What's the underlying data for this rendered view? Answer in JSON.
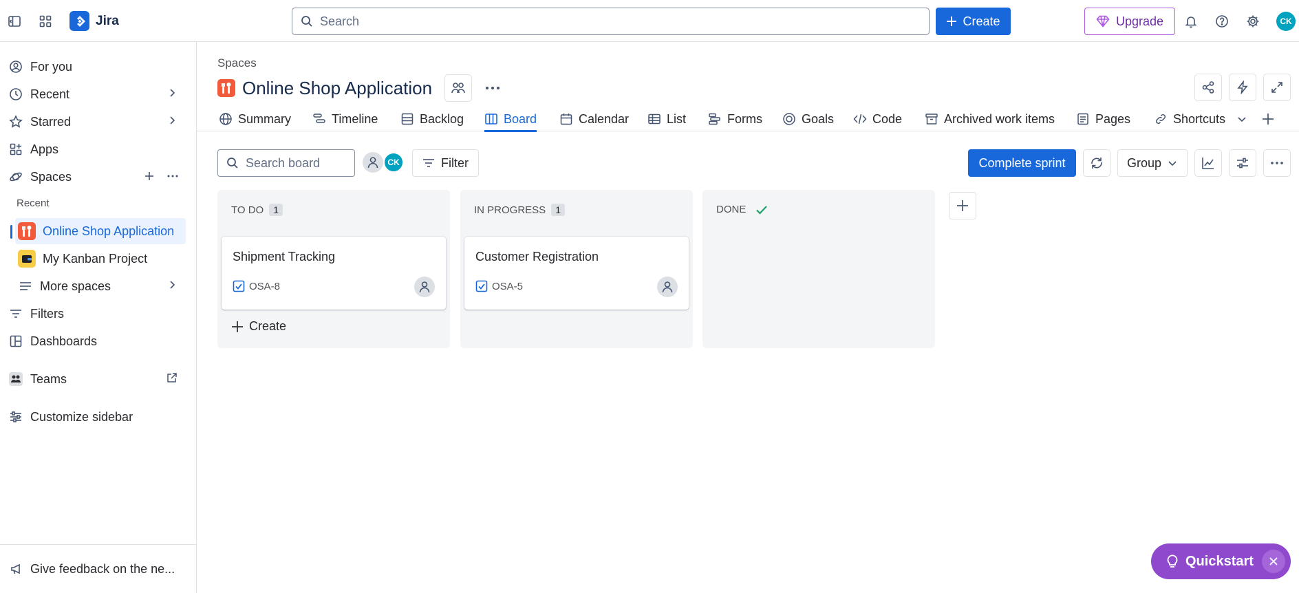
{
  "topbar": {
    "app_name": "Jira",
    "search_placeholder": "Search",
    "create_label": "Create",
    "upgrade_label": "Upgrade",
    "user_initials": "CK"
  },
  "sidebar": {
    "for_you": "For you",
    "recent": "Recent",
    "starred": "Starred",
    "apps": "Apps",
    "spaces": "Spaces",
    "recent_label": "Recent",
    "project_active": "Online Shop Application",
    "project_other": "My Kanban Project",
    "more_spaces": "More spaces",
    "filters": "Filters",
    "dashboards": "Dashboards",
    "teams": "Teams",
    "customize": "Customize sidebar",
    "feedback": "Give feedback on the ne..."
  },
  "header": {
    "breadcrumb": "Spaces",
    "title": "Online Shop Application"
  },
  "tabs": {
    "summary": "Summary",
    "timeline": "Timeline",
    "backlog": "Backlog",
    "board": "Board",
    "calendar": "Calendar",
    "list": "List",
    "forms": "Forms",
    "goals": "Goals",
    "code": "Code",
    "archived": "Archived work items",
    "pages": "Pages",
    "shortcuts": "Shortcuts"
  },
  "toolbar": {
    "search_placeholder": "Search board",
    "avatar_initials": "CK",
    "filter_label": "Filter",
    "complete_sprint": "Complete sprint",
    "group_label": "Group"
  },
  "board": {
    "columns": [
      {
        "name": "TO DO",
        "count": "1",
        "card": {
          "title": "Shipment Tracking",
          "key": "OSA-8"
        },
        "create": "Create"
      },
      {
        "name": "IN PROGRESS",
        "count": "1",
        "card": {
          "title": "Customer Registration",
          "key": "OSA-5"
        }
      },
      {
        "name": "DONE"
      }
    ]
  },
  "quickstart": {
    "label": "Quickstart"
  },
  "colors": {
    "accent": "#1868db",
    "brand_purple": "#8f49cc",
    "done_check": "#22a06b"
  }
}
